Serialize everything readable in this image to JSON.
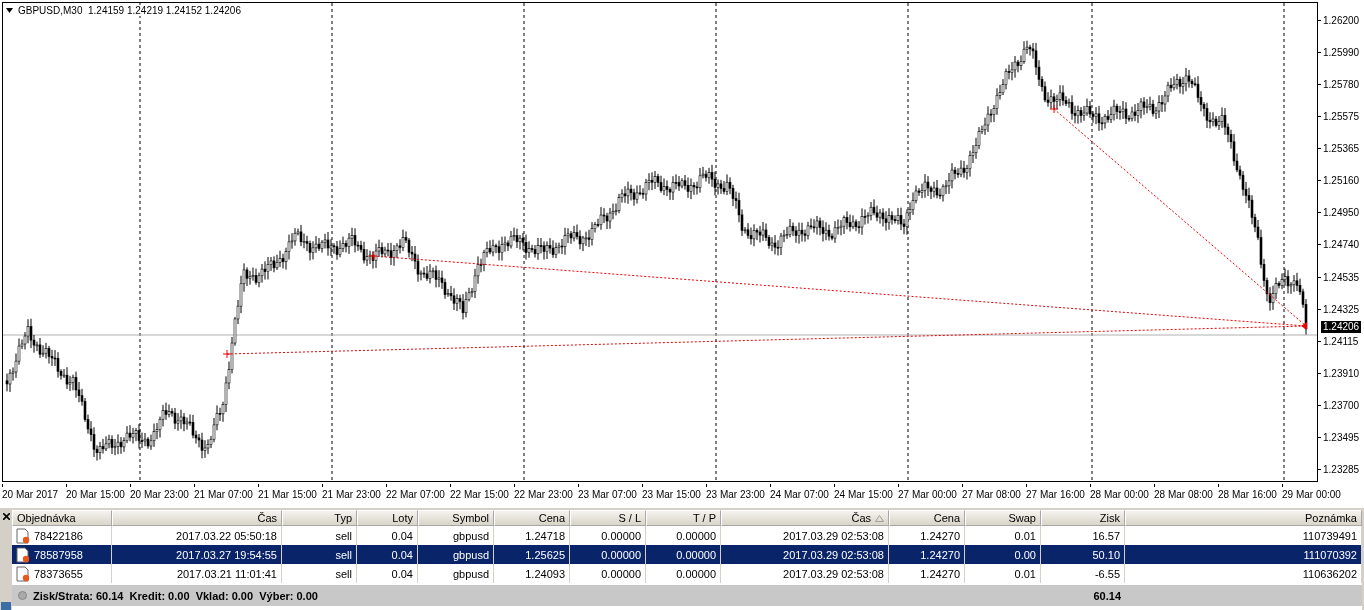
{
  "chart": {
    "symbol_line": "GBPUSD,M30  1.24159 1.24219 1.24152 1.24206",
    "price_ticks": [
      "1.26200",
      "1.25990",
      "1.25780",
      "1.25575",
      "1.25365",
      "1.25160",
      "1.24950",
      "1.24740",
      "1.24535",
      "1.24325",
      "1.24115",
      "1.23910",
      "1.23700",
      "1.23495",
      "1.23285"
    ],
    "current_price": "1.24206",
    "time_labels": [
      "20 Mar 2017",
      "20 Mar 15:00",
      "20 Mar 23:00",
      "21 Mar 07:00",
      "21 Mar 15:00",
      "21 Mar 23:00",
      "22 Mar 07:00",
      "22 Mar 15:00",
      "22 Mar 23:00",
      "23 Mar 07:00",
      "23 Mar 15:00",
      "23 Mar 23:00",
      "24 Mar 07:00",
      "24 Mar 15:00",
      "27 Mar 00:00",
      "27 Mar 08:00",
      "27 Mar 16:00",
      "28 Mar 00:00",
      "28 Mar 08:00",
      "28 Mar 16:00",
      "29 Mar 00:00"
    ]
  },
  "orders": {
    "columns": [
      {
        "label": "Objednávka",
        "sorted": false
      },
      {
        "label": "Čas",
        "sorted": false
      },
      {
        "label": "Typ",
        "sorted": false
      },
      {
        "label": "Loty",
        "sorted": false
      },
      {
        "label": "Symbol",
        "sorted": false
      },
      {
        "label": "Cena",
        "sorted": false
      },
      {
        "label": "S / L",
        "sorted": false
      },
      {
        "label": "T / P",
        "sorted": false
      },
      {
        "label": "Čas",
        "sorted": true
      },
      {
        "label": "Cena",
        "sorted": false
      },
      {
        "label": "Swap",
        "sorted": false
      },
      {
        "label": "Zisk",
        "sorted": false
      },
      {
        "label": "Poznámka",
        "sorted": false
      }
    ],
    "rows": [
      {
        "selected": false,
        "cells": [
          "78422186",
          "2017.03.22 05:50:18",
          "sell",
          "0.04",
          "gbpusd",
          "1.24718",
          "0.00000",
          "0.00000",
          "2017.03.29 02:53:08",
          "1.24270",
          "0.01",
          "16.57",
          "110739491"
        ]
      },
      {
        "selected": true,
        "cells": [
          "78587958",
          "2017.03.27 19:54:55",
          "sell",
          "0.04",
          "gbpusd",
          "1.25625",
          "0.00000",
          "0.00000",
          "2017.03.29 02:53:08",
          "1.24270",
          "0.00",
          "50.10",
          "111070392"
        ]
      },
      {
        "selected": false,
        "cells": [
          "78373655",
          "2017.03.21 11:01:41",
          "sell",
          "0.04",
          "gbpusd",
          "1.24093",
          "0.00000",
          "0.00000",
          "2017.03.29 02:53:08",
          "1.24270",
          "0.01",
          "-6.55",
          "110636202"
        ]
      }
    ],
    "summary": "Zisk/Strata: 60.14  Kredit: 0.00  Vklad: 0.00  Výber: 0.00",
    "total": "60.14"
  }
}
